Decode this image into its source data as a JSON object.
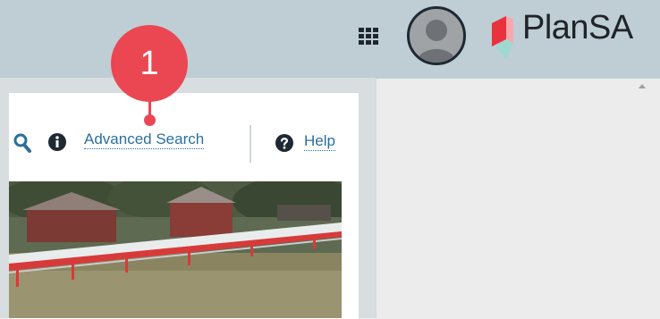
{
  "header": {
    "apps_icon": "grid-apps-icon",
    "avatar_icon": "user-avatar-icon",
    "brand": "PlanSA",
    "brand_colors": [
      "#e8323c",
      "#f6a8ae",
      "#9fd9d2"
    ]
  },
  "toolbar": {
    "search_icon": "search-icon",
    "info_icon": "info-icon",
    "advanced_search_label": "Advanced Search",
    "help_icon": "question-icon",
    "help_label": "Help",
    "link_color": "#2c6f99"
  },
  "callout": {
    "number": "1",
    "color": "#ea4752"
  },
  "image": {
    "description_icon": "property-photo"
  }
}
